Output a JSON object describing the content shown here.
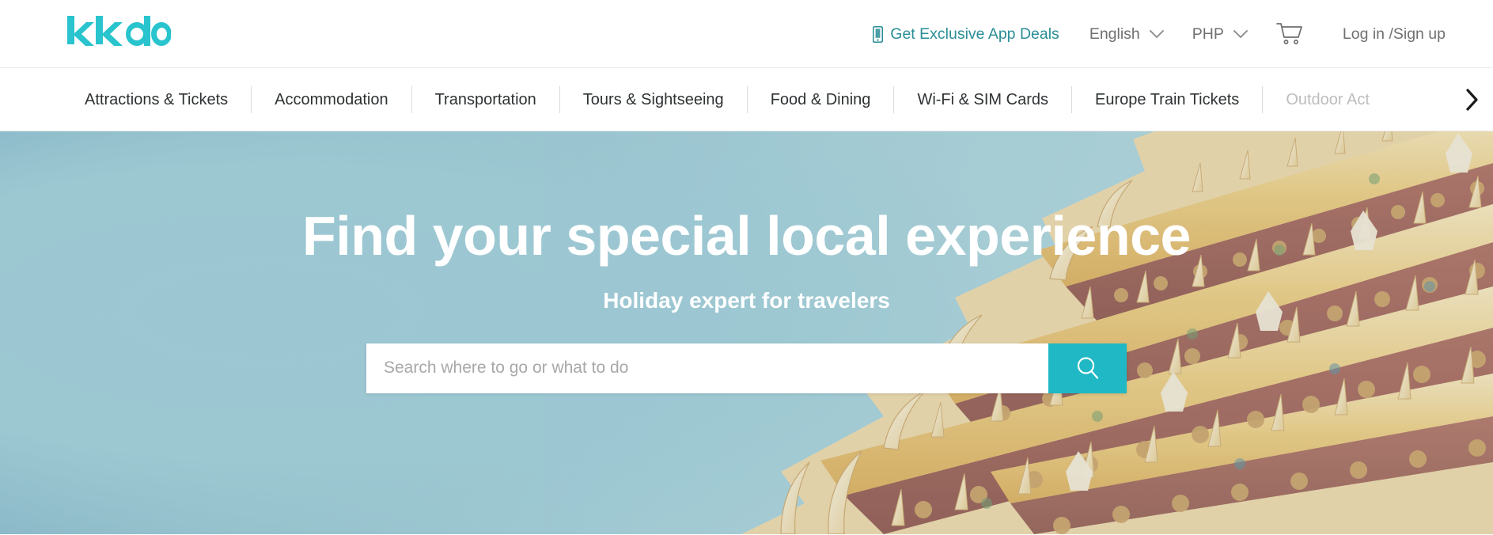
{
  "brand": {
    "logo_text": "kkday",
    "logo_color": "#29c4ce",
    "accent_color": "#20b8c5",
    "link_teal": "#2a8e96"
  },
  "header": {
    "app_deals_label": "Get Exclusive App Deals",
    "app_deals_icon": "mobile-phone-icon",
    "language": "English",
    "currency": "PHP",
    "cart_icon": "shopping-cart-icon",
    "account_label": "Log in /Sign up",
    "chevron_icon": "chevron-down-icon"
  },
  "category_nav": {
    "items": [
      {
        "label": "Attractions & Tickets",
        "faded": false
      },
      {
        "label": "Accommodation",
        "faded": false
      },
      {
        "label": "Transportation",
        "faded": false
      },
      {
        "label": "Tours & Sightseeing",
        "faded": false
      },
      {
        "label": "Food & Dining",
        "faded": false
      },
      {
        "label": "Wi-Fi & SIM Cards",
        "faded": false
      },
      {
        "label": "Europe Train Tickets",
        "faded": false
      },
      {
        "label": "Outdoor Act",
        "faded": true
      }
    ],
    "next_icon": "chevron-right-icon"
  },
  "hero": {
    "title": "Find your special local experience",
    "subtitle": "Holiday expert for travelers",
    "background_image": "thai-temple-wat-arun-photo",
    "search": {
      "placeholder": "Search where to go or what to do",
      "value": "",
      "button_icon": "search-icon"
    }
  }
}
